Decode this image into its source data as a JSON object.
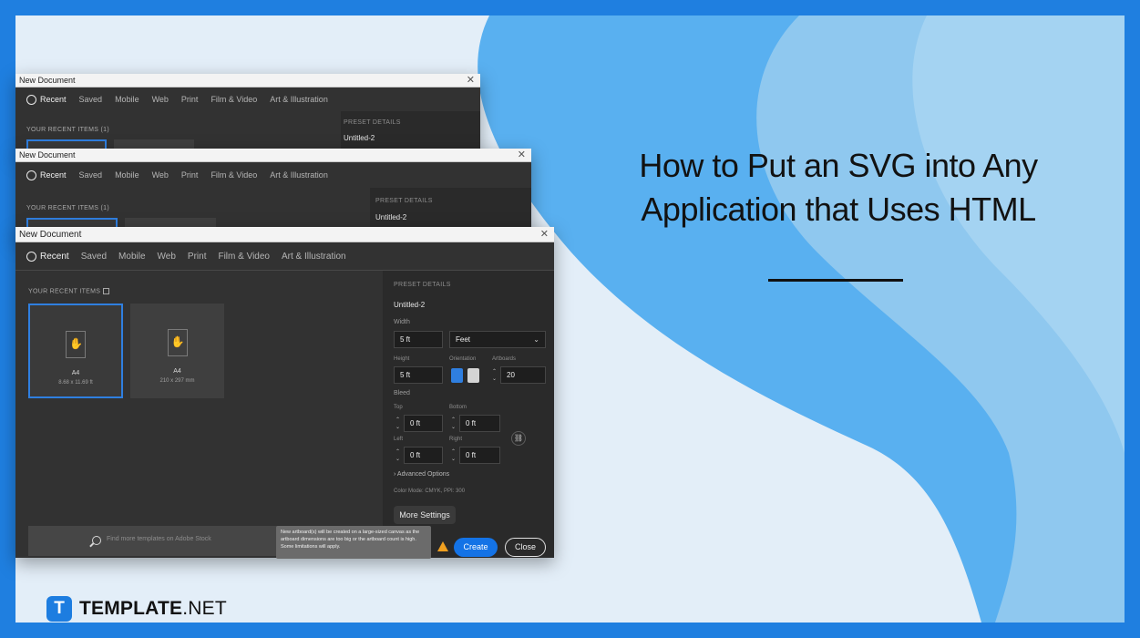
{
  "title": {
    "line1": "How to Put an SVG into Any",
    "line2": "Application that Uses HTML"
  },
  "logo": {
    "mark": "T",
    "brand": "TEMPLATE",
    "suffix": ".NET"
  },
  "dialogs": {
    "d1": {
      "window_title": "New Document",
      "tabs": [
        "Recent",
        "Saved",
        "Mobile",
        "Web",
        "Print",
        "Film & Video",
        "Art & Illustration"
      ],
      "recent_label": "YOUR RECENT ITEMS (1)",
      "preset_label": "PRESET DETAILS",
      "preset_name": "Untitled-2"
    },
    "d2": {
      "window_title": "New Document",
      "tabs": [
        "Recent",
        "Saved",
        "Mobile",
        "Web",
        "Print",
        "Film & Video",
        "Art & Illustration"
      ],
      "recent_label": "YOUR RECENT ITEMS (1)",
      "preset_label": "PRESET DETAILS",
      "preset_name": "Untitled-2"
    },
    "d3": {
      "window_title": "New Document",
      "tabs": [
        "Recent",
        "Saved",
        "Mobile",
        "Web",
        "Print",
        "Film & Video",
        "Art & Illustration"
      ],
      "recent_label": "YOUR RECENT ITEMS",
      "preset_label": "PRESET DETAILS",
      "preset_name": "Untitled-2",
      "thumbs": [
        {
          "name": "A4",
          "size": "8.68 x 11.69 ft"
        },
        {
          "name": "A4",
          "size": "210 x 297 mm"
        }
      ],
      "width_label": "Width",
      "width_value": "5 ft",
      "unit_value": "Feet",
      "height_label": "Height",
      "height_value": "5 ft",
      "orientation_label": "Orientation",
      "artboards_label": "Artboards",
      "artboards_value": "20",
      "bleed_label": "Bleed",
      "top_label": "Top",
      "top_value": "0 ft",
      "bottom_label": "Bottom",
      "bottom_value": "0 ft",
      "left_label": "Left",
      "left_value": "0 ft",
      "right_label": "Right",
      "right_value": "0 ft",
      "advanced_label": "Advanced Options",
      "color_mode": "Color Mode: CMYK, PPI: 300",
      "more_settings": "More Settings",
      "search_placeholder": "Find more templates on Adobe Stock",
      "tooltip": "New artboard(s) will be created on a large-sized canvas as the artboard dimensions are too big or the artboard count is high. Some limitations will apply.",
      "create": "Create",
      "close": "Close"
    }
  },
  "colors": {
    "frame": "#1f7fe0",
    "accent": "#1473e6",
    "dialog_bg": "#323232"
  }
}
